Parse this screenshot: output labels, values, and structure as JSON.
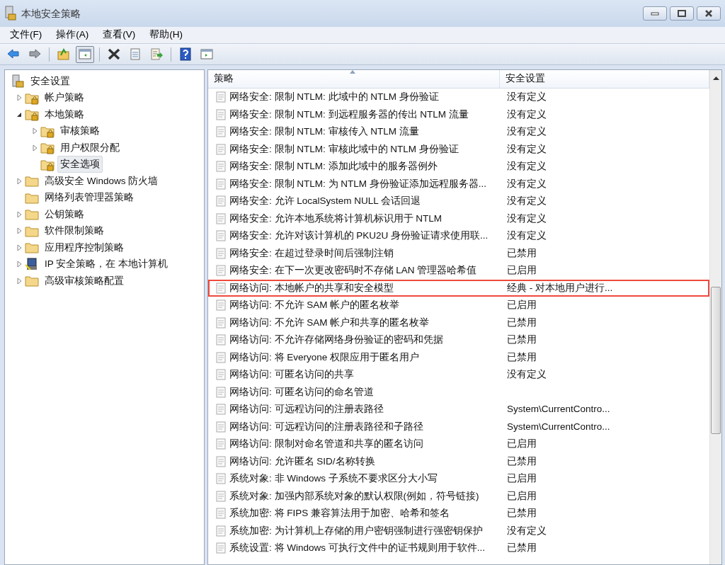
{
  "window": {
    "title": "本地安全策略"
  },
  "menu": [
    "文件(F)",
    "操作(A)",
    "查看(V)",
    "帮助(H)"
  ],
  "toolbar": [
    {
      "kind": "back"
    },
    {
      "kind": "forward"
    },
    {
      "kind": "sep"
    },
    {
      "kind": "up"
    },
    {
      "kind": "tree",
      "selected": true
    },
    {
      "kind": "sep"
    },
    {
      "kind": "delete"
    },
    {
      "kind": "properties"
    },
    {
      "kind": "export"
    },
    {
      "kind": "sep"
    },
    {
      "kind": "help"
    },
    {
      "kind": "panel"
    }
  ],
  "tree": [
    {
      "label": "安全设置",
      "kind": "root",
      "selected": false,
      "children": [
        {
          "label": "帐户策略",
          "kind": "lockfolder",
          "expanded": false,
          "selected": false
        },
        {
          "label": "本地策略",
          "kind": "lockfolder",
          "expanded": true,
          "selected": false,
          "children": [
            {
              "label": "审核策略",
              "kind": "lockfolder",
              "expanded": false,
              "selected": false
            },
            {
              "label": "用户权限分配",
              "kind": "lockfolder",
              "expanded": false,
              "selected": false
            },
            {
              "label": "安全选项",
              "kind": "lockfolder",
              "selected": true
            }
          ]
        },
        {
          "label": "高级安全 Windows 防火墙",
          "kind": "folder",
          "expanded": false,
          "selected": false
        },
        {
          "label": "网络列表管理器策略",
          "kind": "folder",
          "selected": false
        },
        {
          "label": "公钥策略",
          "kind": "folder",
          "expanded": false,
          "selected": false
        },
        {
          "label": "软件限制策略",
          "kind": "folder",
          "expanded": false,
          "selected": false
        },
        {
          "label": "应用程序控制策略",
          "kind": "folder",
          "expanded": false,
          "selected": false
        },
        {
          "label": "IP 安全策略，在 本地计算机",
          "kind": "computer",
          "expanded": false,
          "selected": false
        },
        {
          "label": "高级审核策略配置",
          "kind": "folder",
          "expanded": false,
          "selected": false
        }
      ]
    }
  ],
  "table": {
    "columns": [
      "策略",
      "安全设置"
    ],
    "rows": [
      {
        "policy": "网络安全: 限制 NTLM: 此域中的 NTLM 身份验证",
        "setting": "没有定义",
        "highlighted": false
      },
      {
        "policy": "网络安全: 限制 NTLM: 到远程服务器的传出 NTLM 流量",
        "setting": "没有定义",
        "highlighted": false
      },
      {
        "policy": "网络安全: 限制 NTLM: 审核传入 NTLM 流量",
        "setting": "没有定义",
        "highlighted": false
      },
      {
        "policy": "网络安全: 限制 NTLM: 审核此域中的 NTLM 身份验证",
        "setting": "没有定义",
        "highlighted": false
      },
      {
        "policy": "网络安全: 限制 NTLM: 添加此域中的服务器例外",
        "setting": "没有定义",
        "highlighted": false
      },
      {
        "policy": "网络安全: 限制 NTLM: 为 NTLM 身份验证添加远程服务器...",
        "setting": "没有定义",
        "highlighted": false
      },
      {
        "policy": "网络安全: 允许 LocalSystem NULL 会话回退",
        "setting": "没有定义",
        "highlighted": false
      },
      {
        "policy": "网络安全: 允许本地系统将计算机标识用于 NTLM",
        "setting": "没有定义",
        "highlighted": false
      },
      {
        "policy": "网络安全: 允许对该计算机的 PKU2U 身份验证请求使用联...",
        "setting": "没有定义",
        "highlighted": false
      },
      {
        "policy": "网络安全: 在超过登录时间后强制注销",
        "setting": "已禁用",
        "highlighted": false
      },
      {
        "policy": "网络安全: 在下一次更改密码时不存储 LAN 管理器哈希值",
        "setting": "已启用",
        "highlighted": false
      },
      {
        "policy": "网络访问: 本地帐户的共享和安全模型",
        "setting": "经典 - 对本地用户进行...",
        "highlighted": true
      },
      {
        "policy": "网络访问: 不允许 SAM 帐户的匿名枚举",
        "setting": "已启用",
        "highlighted": false
      },
      {
        "policy": "网络访问: 不允许 SAM 帐户和共享的匿名枚举",
        "setting": "已禁用",
        "highlighted": false
      },
      {
        "policy": "网络访问: 不允许存储网络身份验证的密码和凭据",
        "setting": "已禁用",
        "highlighted": false
      },
      {
        "policy": "网络访问: 将 Everyone 权限应用于匿名用户",
        "setting": "已禁用",
        "highlighted": false
      },
      {
        "policy": "网络访问: 可匿名访问的共享",
        "setting": "没有定义",
        "highlighted": false
      },
      {
        "policy": "网络访问: 可匿名访问的命名管道",
        "highlighted": false
      },
      {
        "policy": "网络访问: 可远程访问的注册表路径",
        "setting": "System\\CurrentContro...",
        "highlighted": false
      },
      {
        "policy": "网络访问: 可远程访问的注册表路径和子路径",
        "setting": "System\\CurrentContro...",
        "highlighted": false
      },
      {
        "policy": "网络访问: 限制对命名管道和共享的匿名访问",
        "setting": "已启用",
        "highlighted": false
      },
      {
        "policy": "网络访问: 允许匿名 SID/名称转换",
        "setting": "已禁用",
        "highlighted": false
      },
      {
        "policy": "系统对象: 非 Windows 子系统不要求区分大小写",
        "setting": "已启用",
        "highlighted": false
      },
      {
        "policy": "系统对象: 加强内部系统对象的默认权限(例如，符号链接)",
        "setting": "已启用",
        "highlighted": false
      },
      {
        "policy": "系统加密: 将 FIPS 兼容算法用于加密、哈希和签名",
        "setting": "已禁用",
        "highlighted": false
      },
      {
        "policy": "系统加密: 为计算机上存储的用户密钥强制进行强密钥保护",
        "setting": "没有定义",
        "highlighted": false
      },
      {
        "policy": "系统设置: 将 Windows 可执行文件中的证书规则用于软件...",
        "setting": "已禁用",
        "highlighted": false
      }
    ]
  }
}
